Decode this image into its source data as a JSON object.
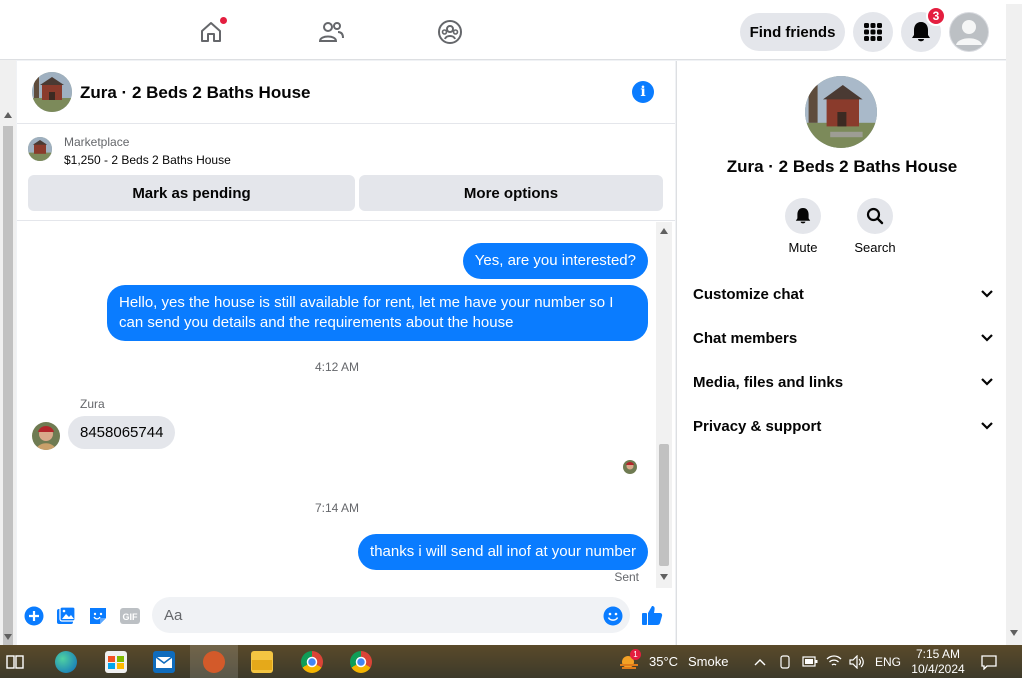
{
  "topbar": {
    "find_friends": "Find friends",
    "notification_count": "3"
  },
  "chat": {
    "title": "Zura · 2 Beds 2 Baths House",
    "marketplace_label": "Marketplace",
    "listing": "$1,250 - 2 Beds 2 Baths House",
    "mark_pending": "Mark as pending",
    "more_options": "More options"
  },
  "messages": {
    "out1": "Yes, are you interested?",
    "out2": "Hello, yes the house is still available for rent, let me have your number so I can send you details and the requirements about the house",
    "time1": "4:12 AM",
    "sender": "Zura",
    "in1": "8458065744",
    "time2": "7:14 AM",
    "out3": "thanks i will send all inof at your number",
    "status": "Sent"
  },
  "composer": {
    "placeholder": "Aa",
    "gif_label": "GIF"
  },
  "right_panel": {
    "name": "Zura · 2 Beds 2 Baths House",
    "mute": "Mute",
    "search": "Search",
    "sections": [
      "Customize chat",
      "Chat members",
      "Media, files and links",
      "Privacy & support"
    ]
  },
  "taskbar": {
    "weather_temp": "35°C",
    "weather_desc": "Smoke",
    "weather_badge": "1",
    "language": "ENG",
    "time": "7:15 AM",
    "date": "10/4/2024"
  },
  "colors": {
    "accent": "#0a7cff",
    "badge": "#e41e3f"
  }
}
